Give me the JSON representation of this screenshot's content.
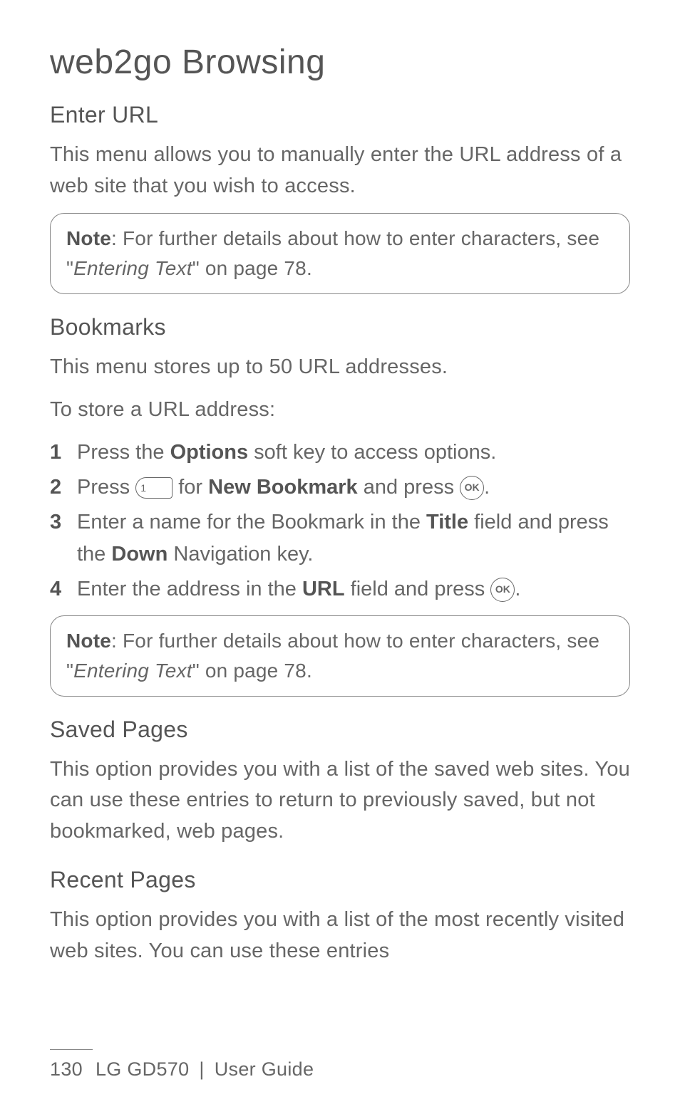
{
  "title": "web2go Browsing",
  "sections": {
    "enter_url": {
      "heading": "Enter URL",
      "para": "This menu allows you to manually enter the URL address of a web site that you wish to access.",
      "note_label": "Note",
      "note_text1": ": For further details about how to enter characters, see \"",
      "note_emph": "Entering Text",
      "note_text2": "\" on page 78."
    },
    "bookmarks": {
      "heading": "Bookmarks",
      "para1": "This menu stores up to 50 URL addresses.",
      "para2": "To store a URL address:",
      "steps": [
        {
          "num": "1",
          "pre": "Press the ",
          "bold1": "Options",
          "post": " soft key to access options."
        },
        {
          "num": "2",
          "pre": "Press ",
          "key": "1",
          "mid": " for ",
          "bold1": "New Bookmark",
          "mid2": " and press ",
          "ok": "OK",
          "post": "."
        },
        {
          "num": "3",
          "pre": "Enter a name for the Bookmark in the ",
          "bold1": "Title",
          "mid": " field and press the ",
          "bold2": "Down",
          "post": " Navigation key."
        },
        {
          "num": "4",
          "pre": "Enter the address in the ",
          "bold1": "URL",
          "mid": " field and press ",
          "ok": "OK",
          "post": "."
        }
      ],
      "note_label": "Note",
      "note_text1": ": For further details about how to enter characters, see \"",
      "note_emph": "Entering Text",
      "note_text2": "\" on page 78."
    },
    "saved_pages": {
      "heading": "Saved Pages",
      "para": "This option provides you with a list of the saved web sites. You can use these entries to return to previously saved, but not bookmarked, web pages."
    },
    "recent_pages": {
      "heading": "Recent Pages",
      "para": "This option provides you with a list of the most recently visited web sites. You can use these entries"
    }
  },
  "footer": {
    "page_num": "130",
    "model": "LG GD570",
    "sep": "|",
    "label": "User Guide"
  }
}
